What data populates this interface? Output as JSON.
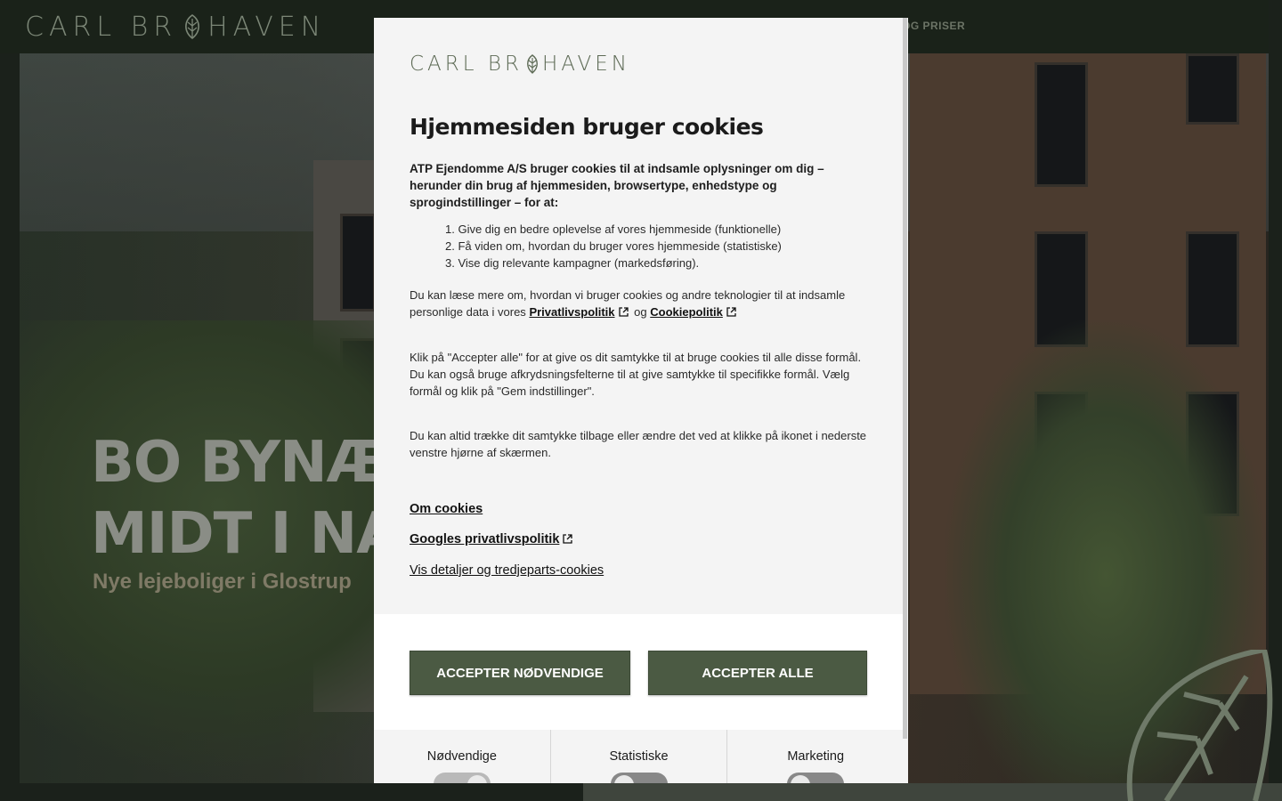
{
  "site": {
    "logo_left": "CARL BR",
    "logo_right": "HAVEN",
    "nav_partial": "R OG PRISER",
    "hero_title_line1": "BO BYNÆRT",
    "hero_title_line2": "MIDT I NATU",
    "hero_subtitle": "Nye lejeboliger i Glostrup"
  },
  "modal": {
    "logo_left": "CARL BR",
    "logo_right": "HAVEN",
    "title": "Hjemmesiden bruger cookies",
    "intro": "ATP Ejendomme A/S bruger cookies til at indsamle oplysninger om dig – herunder din brug af hjemmesiden, browsertype, enhedstype og sprogindstillinger – for at:",
    "purposes": [
      "1. Give dig en bedre oplevelse af vores hjemmeside (funktionelle)",
      "2. Få viden om, hvordan du bruger vores hjemmeside (statistiske)",
      "3. Vise dig relevante kampagner (markedsføring)."
    ],
    "policy_text_before": "Du kan læse mere om, hvordan vi bruger cookies og andre teknologier til at indsamle personlige data i vores",
    "privacy_link": "Privatlivspolitik",
    "policy_and": "og",
    "cookie_link": "Cookiepolitik",
    "accept_info": "Klik på \"Accepter alle\" for at give os dit samtykke til at bruge cookies til alle disse formål. Du kan også bruge afkrydsningsfelterne til at give samtykke til specifikke formål. Vælg formål og klik på \"Gem indstillinger\".",
    "withdraw_info": "Du kan altid trække dit samtykke tilbage eller ændre det ved at klikke på ikonet i nederste venstre hjørne af skærmen.",
    "about_cookies_link": "Om cookies",
    "google_privacy_link": "Googles privatlivspolitik",
    "details_link": "Vis detaljer og tredjeparts-cookies",
    "btn_necessary": "ACCEPTER NØDVENDIGE",
    "btn_all": "ACCEPTER ALLE",
    "categories": [
      {
        "label": "Nødvendige",
        "on": true
      },
      {
        "label": "Statistiske",
        "on": false
      },
      {
        "label": "Marketing",
        "on": false
      }
    ]
  },
  "colors": {
    "brand_green": "#4b5a43",
    "logo_green": "#5d6a55"
  }
}
